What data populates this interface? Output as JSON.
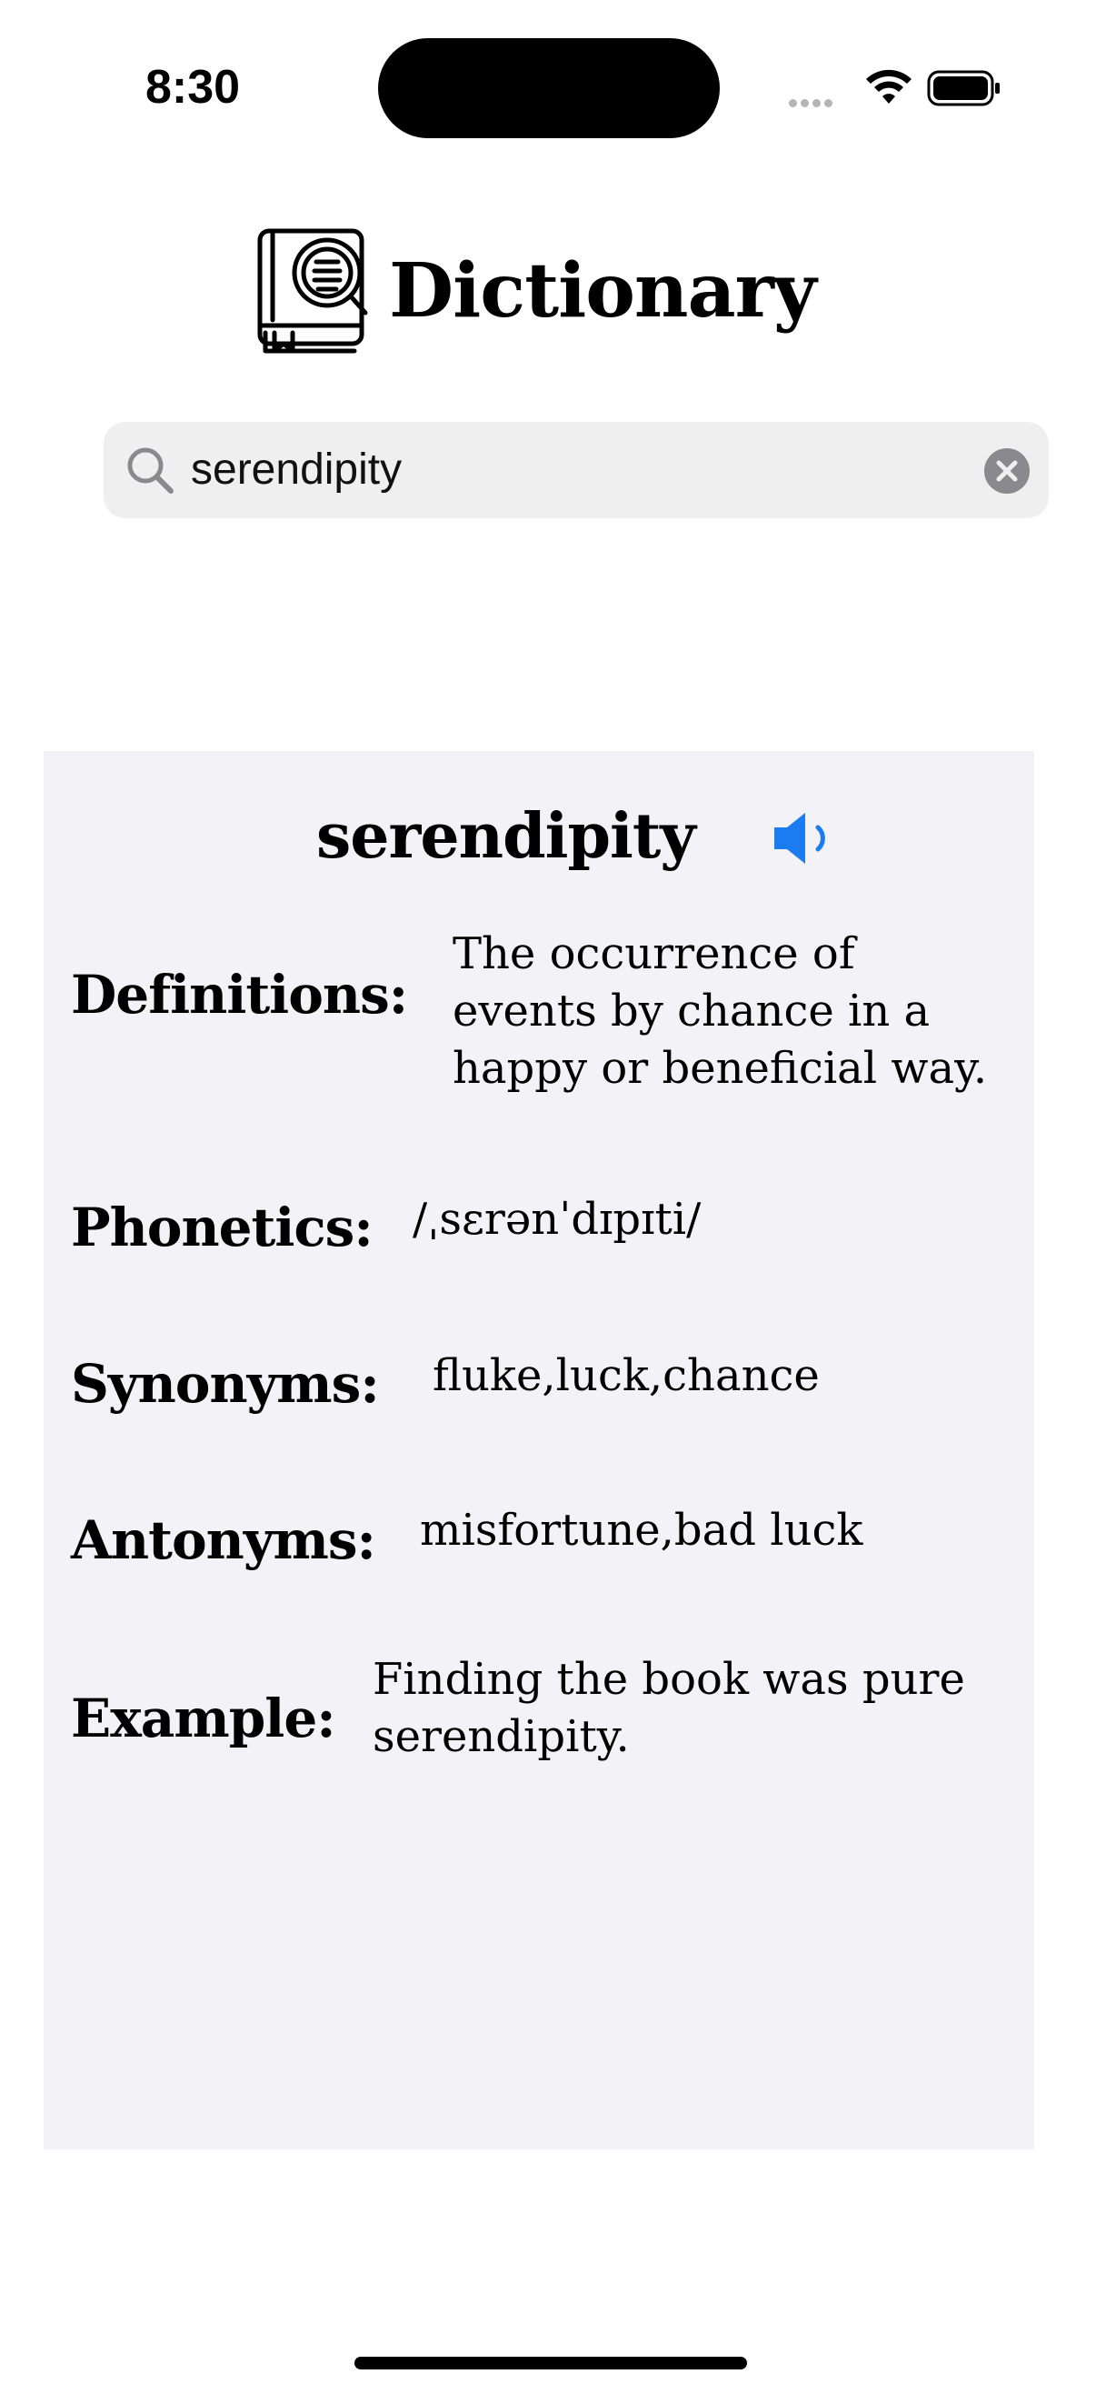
{
  "status_bar": {
    "time": "8:30"
  },
  "header": {
    "title": "Dictionary",
    "icon": "book-magnifier-icon"
  },
  "search": {
    "value": "serendipity"
  },
  "entry": {
    "word": "serendipity",
    "definitions_label": "Definitions:",
    "definitions": "The occurrence of events by chance in a happy or beneficial way.",
    "phonetics_label": "Phonetics:",
    "phonetics": "/ˌsɛrənˈdɪpɪti/",
    "synonyms_label": "Synonyms:",
    "synonyms": "fluke,luck,chance",
    "antonyms_label": "Antonyms:",
    "antonyms": "misfortune,bad luck",
    "example_label": "Example:",
    "example": "Finding the book was pure serendipity."
  },
  "colors": {
    "accent": "#1a7cf0",
    "card_bg": "#f2f2f7",
    "search_bg": "#efefef"
  }
}
